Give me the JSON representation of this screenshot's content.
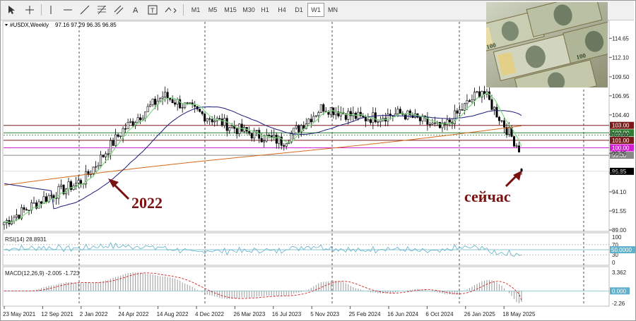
{
  "toolbar": {
    "tools": [
      "cursor-icon",
      "crosshair-icon",
      "vertical-line-icon",
      "horizontal-line-icon",
      "trendline-icon",
      "fibonacci-icon",
      "text-icon",
      "label-icon",
      "arrows-icon"
    ],
    "timeframes": [
      "M1",
      "M5",
      "M15",
      "M30",
      "H1",
      "H4",
      "D1",
      "W1",
      "MN"
    ],
    "active_timeframe": "W1"
  },
  "header": {
    "symbol": "#USDX,Weekly",
    "ohlc": "97.16 97.29 96.35 96.85"
  },
  "price_axis": [
    "114.65",
    "112.10",
    "109.50",
    "106.95",
    "104.40",
    "101.80",
    "99.25",
    "96.65",
    "94.10",
    "91.55",
    "89.00"
  ],
  "time_axis": [
    "23 May 2021",
    "12 Sep 2021",
    "2 Jan 2022",
    "24 Apr 2022",
    "14 Aug 2022",
    "4 Dec 2022",
    "26 Mar 2023",
    "16 Jul 2023",
    "5 Nov 2023",
    "25 Feb 2024",
    "16 Jun 2024",
    "6 Oct 2024",
    "26 Jan 2025",
    "18 May 2025"
  ],
  "levels": [
    {
      "value": 103.0,
      "label": "103.00",
      "color": "#7a1a1a"
    },
    {
      "value": 102.0,
      "label": "102.00",
      "color": "#2e7d32"
    },
    {
      "value": 101.0,
      "label": "101.00",
      "color": "#7a1a1a"
    },
    {
      "value": 100.0,
      "label": "100.00",
      "color": "#d020d0"
    },
    {
      "value": 99.0,
      "label": "99.00",
      "color": "#888888"
    },
    {
      "value": 96.85,
      "label": "96.85",
      "color": "#000000"
    }
  ],
  "annotations": {
    "year_label": "2022",
    "now_label": "сейчас"
  },
  "rsi": {
    "title": "RSI(14) 28.8931",
    "axis": [
      "100",
      "70",
      "50",
      "30",
      "0"
    ],
    "level_label": "50.0000"
  },
  "macd": {
    "title": "MACD(12,26,9) -2.005 -1.723",
    "axis": [
      "3.362",
      "0.000",
      "-2.26"
    ],
    "zero_label": "0.000"
  },
  "colors": {
    "up_candle": "#000000",
    "down_candle": "#000000",
    "ma_fast": "#7ed87e",
    "ma_mid": "#1c1c7a",
    "ma_slow": "#d2691e",
    "rsi_line": "#5fb0c8",
    "macd_hist": "#9a9a9a",
    "macd_signal": "#d02020",
    "annotation_arrow": "#7a1010"
  },
  "chart_data": {
    "type": "candlestick",
    "symbol": "#USDX",
    "timeframe": "Weekly",
    "ylim": [
      89.0,
      116.0
    ],
    "x": [
      "23 May 2021",
      "12 Sep 2021",
      "2 Jan 2022",
      "24 Apr 2022",
      "14 Aug 2022",
      "4 Dec 2022",
      "26 Mar 2023",
      "16 Jul 2023",
      "5 Nov 2023",
      "25 Feb 2024",
      "16 Jun 2024",
      "6 Oct 2024",
      "26 Jan 2025",
      "18 May 2025"
    ],
    "close": [
      90.0,
      93.2,
      95.7,
      102.5,
      107.0,
      104.4,
      102.2,
      100.8,
      105.5,
      103.9,
      104.6,
      102.5,
      107.8,
      99.4
    ],
    "last": {
      "open": 97.16,
      "high": 97.29,
      "low": 96.35,
      "close": 96.85
    },
    "rsi_last": 28.8931,
    "macd_last": {
      "macd": -2.005,
      "signal": -1.723
    }
  }
}
